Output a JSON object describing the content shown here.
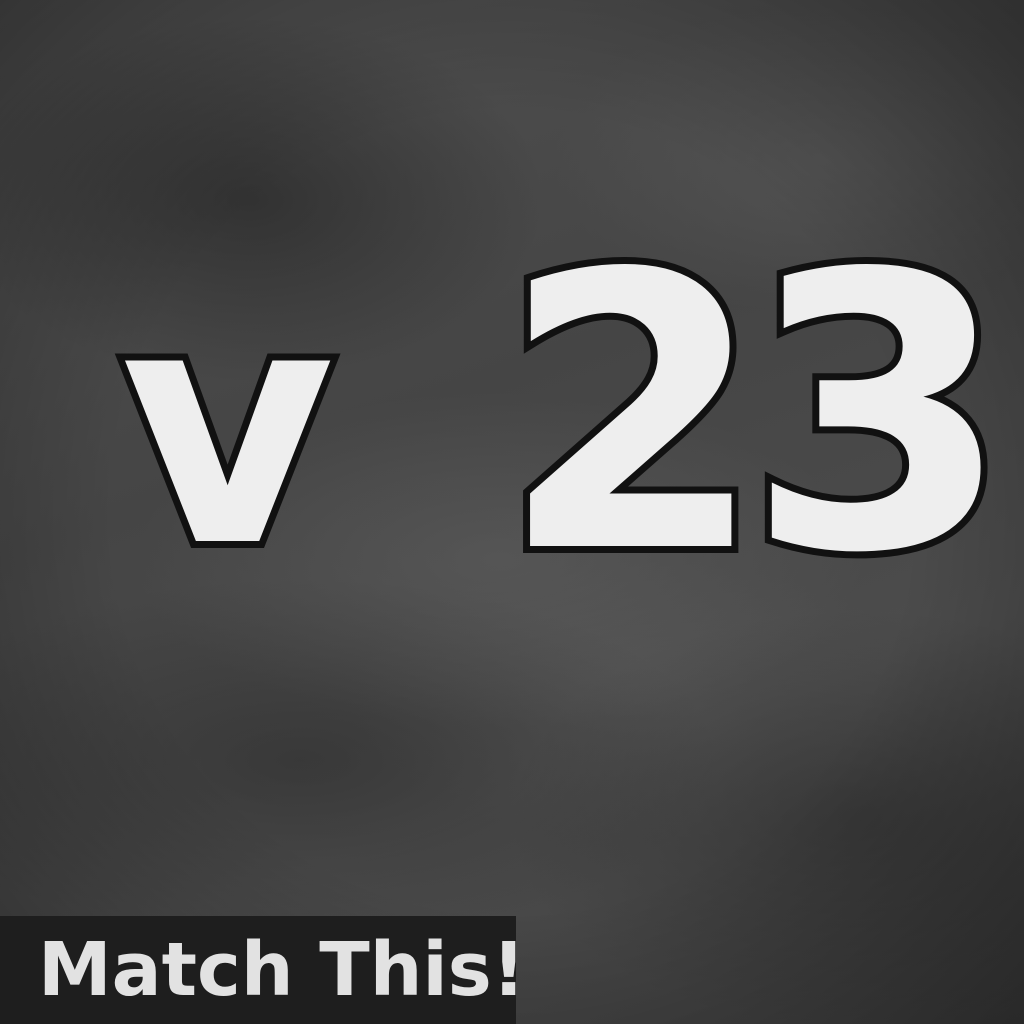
{
  "challenge": {
    "left_value": "v",
    "right_value": "23"
  },
  "prompt": {
    "label": "Match This!"
  },
  "colors": {
    "glyph_fill": "#eeeeee",
    "glyph_outline": "#111111",
    "background": "#4a4a4a",
    "label_bar": "#1e1e1e",
    "label_text": "#e2e2e2"
  }
}
